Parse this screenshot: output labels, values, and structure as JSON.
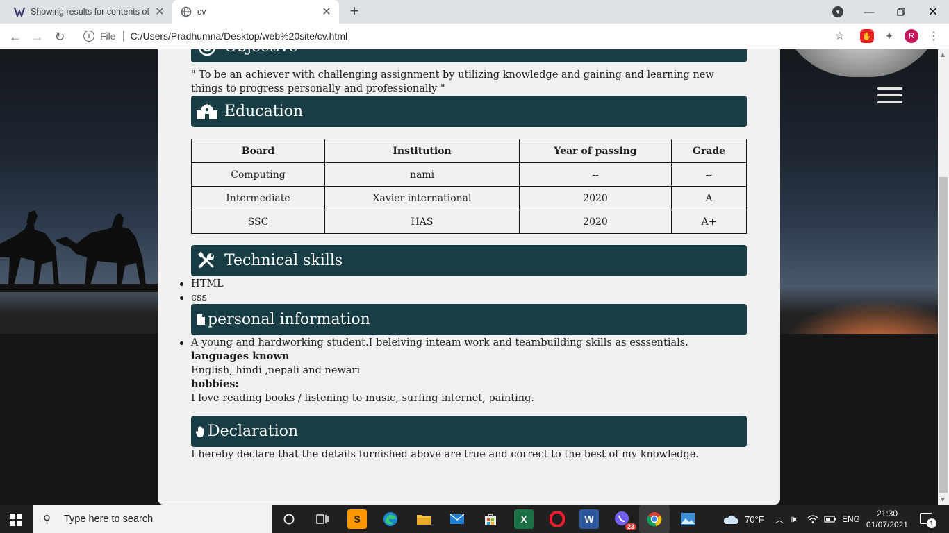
{
  "browser": {
    "tabs": [
      {
        "title": "Showing results for contents of te",
        "active": false
      },
      {
        "title": "cv",
        "active": true
      }
    ],
    "url_label": "File",
    "url": "C:/Users/Pradhumna/Desktop/web%20site/cv.html",
    "profile_initial": "R"
  },
  "cv": {
    "objective": {
      "heading": "Objective",
      "text": "\" To be an achiever with challenging assignment by utilizing knowledge and gaining and learning new things to progress personally and professionally \""
    },
    "education": {
      "heading": "Education",
      "columns": [
        "Board",
        "Institution",
        "Year of passing",
        "Grade"
      ],
      "rows": [
        [
          "Computing",
          "nami",
          "--",
          "--"
        ],
        [
          "Intermediate",
          "Xavier international",
          "2020",
          "A"
        ],
        [
          "SSC",
          "HAS",
          "2020",
          "A+"
        ]
      ]
    },
    "skills": {
      "heading": "Technical skills",
      "items": [
        "HTML",
        "css"
      ]
    },
    "personal": {
      "heading": "personal information",
      "summary": "A young and hardworking student.I beleiving inteam work and teambuilding skills as esssentials.",
      "languages_label": "languages known",
      "languages": "English, hindi ,nepali and newari",
      "hobbies_label": "hobbies:",
      "hobbies": "I love reading books / listening to music, surfing internet, painting."
    },
    "declaration": {
      "heading": "Declaration",
      "text": "I hereby declare that the details furnished above are true and correct to the best of my knowledge."
    }
  },
  "taskbar": {
    "search_placeholder": "Type here to search",
    "viber_badge": "23",
    "weather": "70°F",
    "language": "ENG",
    "time": "21:30",
    "date": "01/07/2021",
    "notification_count": "1"
  },
  "colors": {
    "accent_bar": "#183d44",
    "sheet_bg": "#f1f1f1"
  }
}
